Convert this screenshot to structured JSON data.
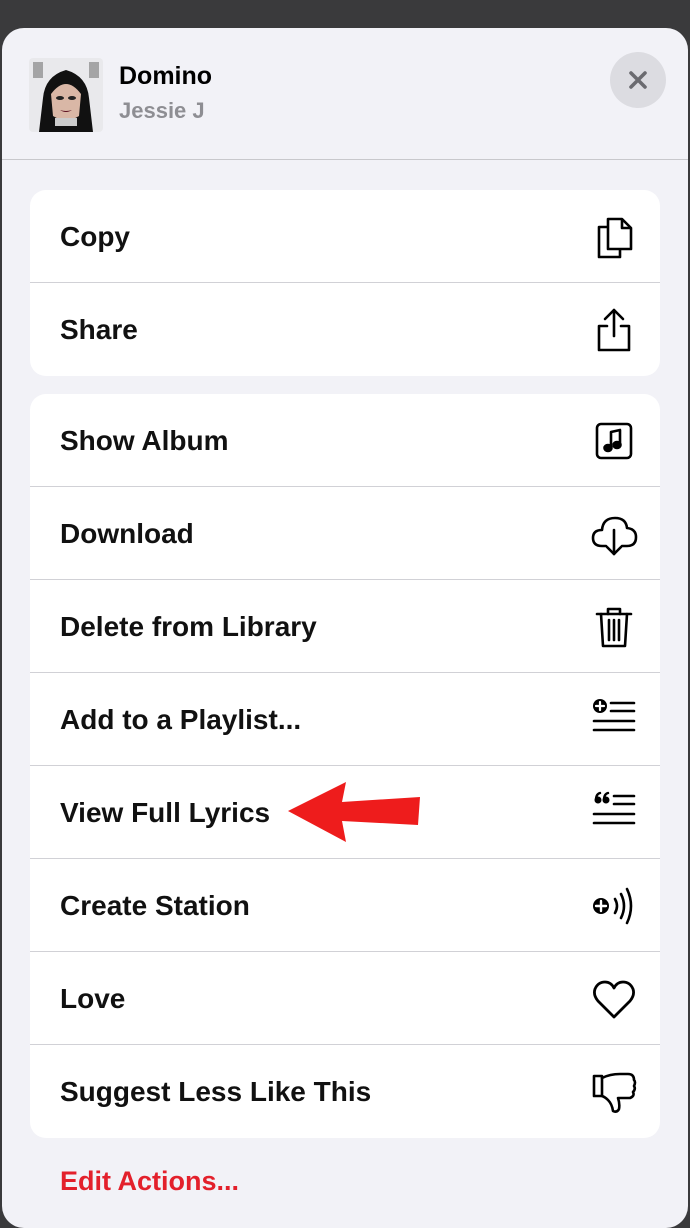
{
  "song": {
    "title": "Domino",
    "artist": "Jessie J"
  },
  "groups": [
    {
      "items": [
        {
          "label": "Copy",
          "icon": "copy-icon"
        },
        {
          "label": "Share",
          "icon": "share-icon"
        }
      ]
    },
    {
      "items": [
        {
          "label": "Show Album",
          "icon": "album-icon"
        },
        {
          "label": "Download",
          "icon": "download-icon"
        },
        {
          "label": "Delete from Library",
          "icon": "trash-icon"
        },
        {
          "label": "Add to a Playlist...",
          "icon": "add-to-playlist-icon"
        },
        {
          "label": "View Full Lyrics",
          "icon": "lyrics-icon"
        },
        {
          "label": "Create Station",
          "icon": "station-icon"
        },
        {
          "label": "Love",
          "icon": "heart-icon"
        },
        {
          "label": "Suggest Less Like This",
          "icon": "thumbs-down-icon"
        }
      ]
    }
  ],
  "footer": {
    "edit_actions": "Edit Actions..."
  },
  "colors": {
    "accent_red": "#e3202b",
    "annotation_arrow": "#ee1c1c"
  }
}
